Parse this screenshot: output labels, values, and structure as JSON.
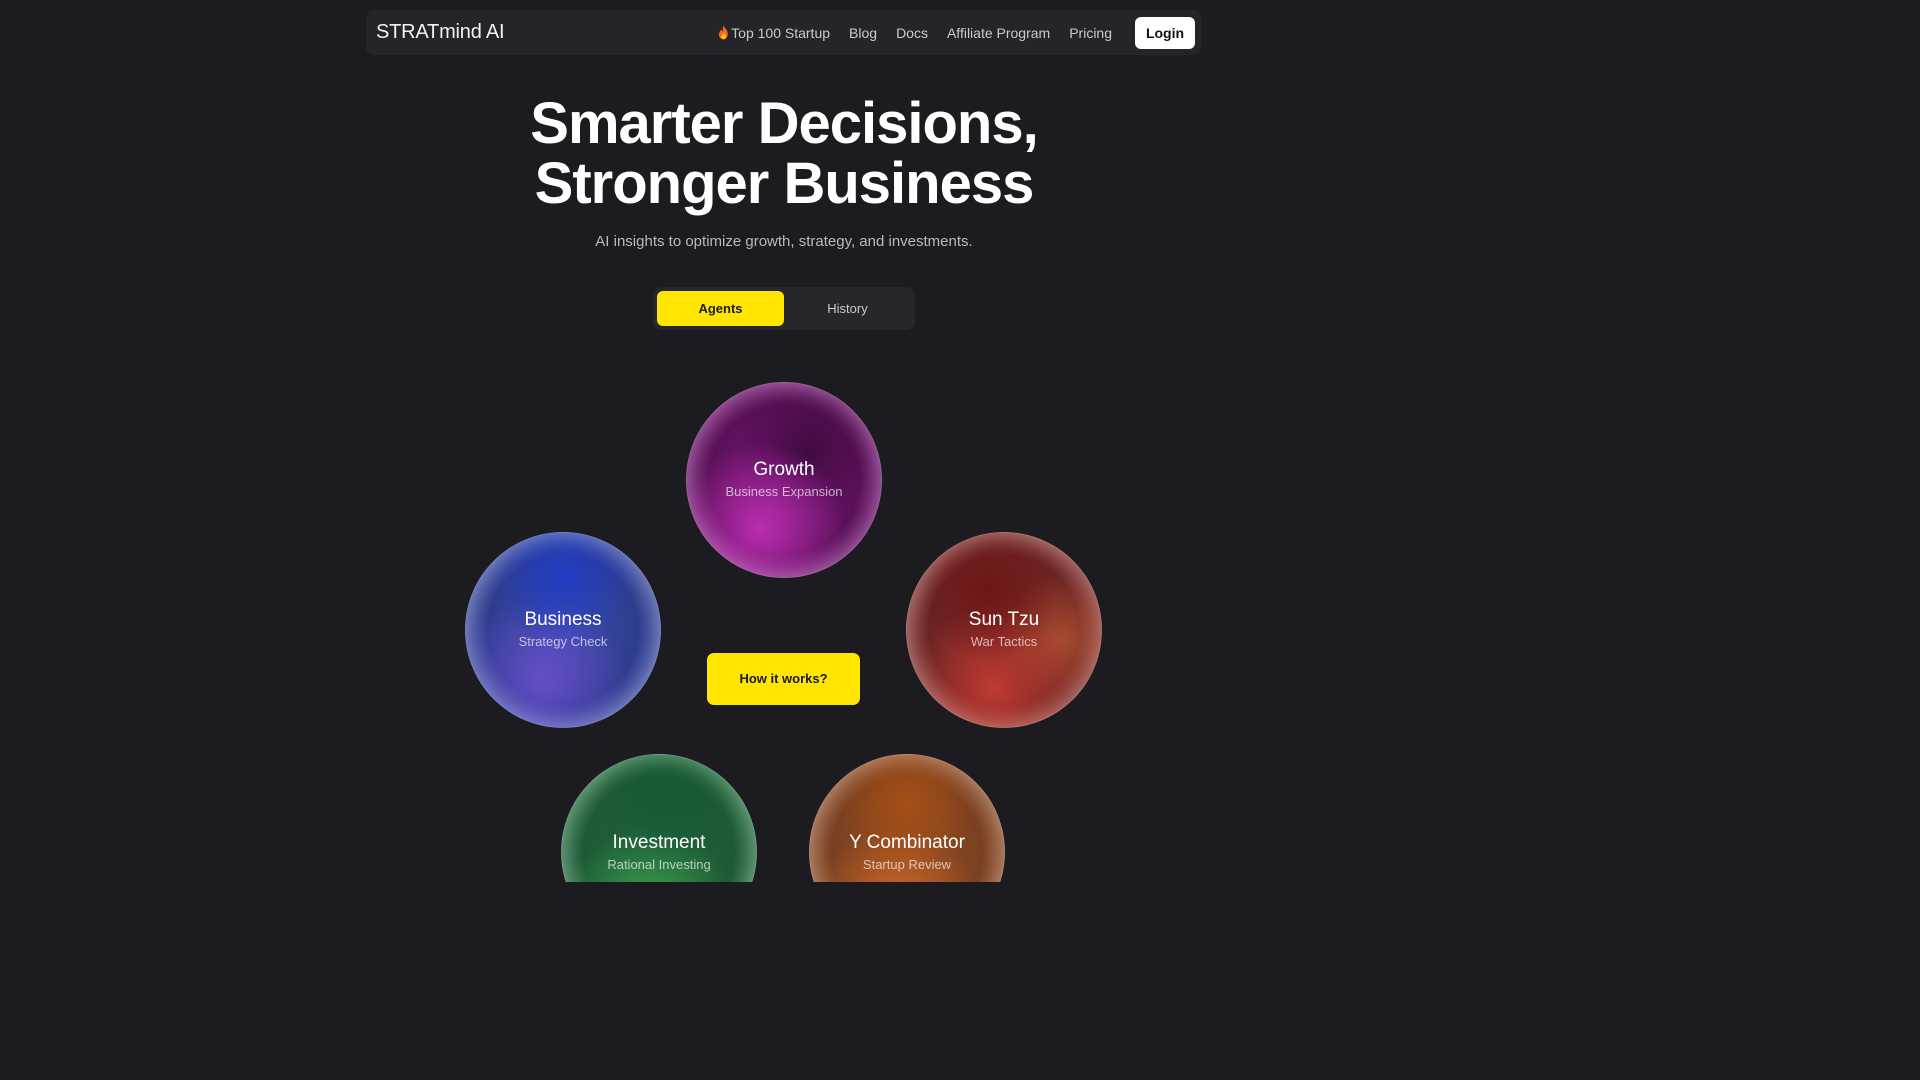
{
  "nav": {
    "brand": "STRATmind AI",
    "links": [
      {
        "label": "Top 100 Startup",
        "icon": "fire-icon"
      },
      {
        "label": "Blog"
      },
      {
        "label": "Docs"
      },
      {
        "label": "Affiliate Program"
      },
      {
        "label": "Pricing"
      }
    ],
    "login_label": "Login"
  },
  "hero": {
    "title_line1": "Smarter Decisions,",
    "title_line2": "Stronger Business",
    "subtitle": "AI insights to optimize growth, strategy, and investments."
  },
  "tabs": [
    {
      "label": "Agents",
      "active": true
    },
    {
      "label": "History",
      "active": false
    }
  ],
  "agents": [
    {
      "title": "Growth",
      "subtitle": "Business Expansion",
      "color": "#7a167a"
    },
    {
      "title": "Business",
      "subtitle": "Strategy Check",
      "color": "#3a4aa8"
    },
    {
      "title": "Sun Tzu",
      "subtitle": "War Tactics",
      "color": "#7d2a28"
    },
    {
      "title": "Investment",
      "subtitle": "Rational Investing",
      "color": "#22603a"
    },
    {
      "title": "Y Combinator",
      "subtitle": "Startup Review",
      "color": "#8e4a22"
    }
  ],
  "cta": {
    "label": "How it works?"
  },
  "colors": {
    "background": "#1b1b20",
    "accent": "#ffe500"
  }
}
